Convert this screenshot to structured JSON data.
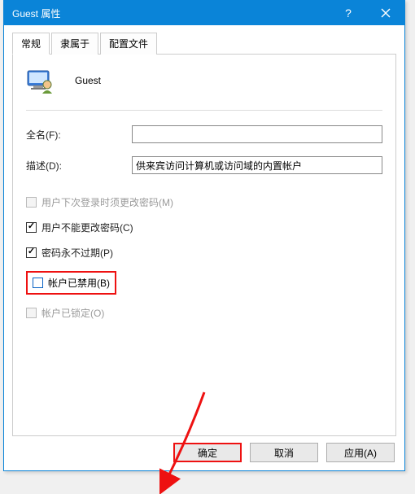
{
  "window": {
    "title": "Guest 属性"
  },
  "tabs": {
    "general": "常规",
    "memberof": "隶属于",
    "profiles": "配置文件"
  },
  "identity": {
    "username": "Guest"
  },
  "fields": {
    "fullname_label": "全名(F):",
    "fullname_value": "",
    "description_label": "描述(D):",
    "description_value": "供来宾访问计算机或访问域的内置帐户"
  },
  "checks": {
    "must_change": "用户下次登录时须更改密码(M)",
    "cannot_change": "用户不能更改密码(C)",
    "never_expires": "密码永不过期(P)",
    "disabled": "帐户已禁用(B)",
    "locked": "帐户已锁定(O)"
  },
  "buttons": {
    "ok": "确定",
    "cancel": "取消",
    "apply": "应用(A)"
  }
}
